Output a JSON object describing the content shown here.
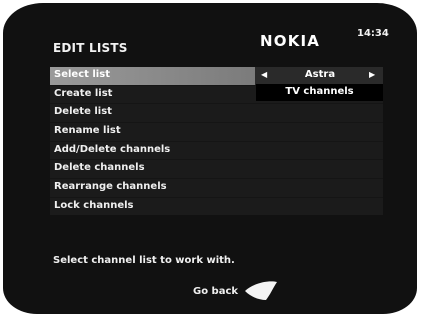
{
  "header": {
    "title": "EDIT LISTS",
    "brand": "NOKIA",
    "time": "14:34"
  },
  "menu": {
    "items": [
      {
        "label": "Select list"
      },
      {
        "label": "Create list"
      },
      {
        "label": "Delete list"
      },
      {
        "label": "Rename list"
      },
      {
        "label": "Add/Delete channels"
      },
      {
        "label": "Delete channels"
      },
      {
        "label": "Rearrange channels"
      },
      {
        "label": "Lock channels"
      }
    ],
    "selected_index": 0,
    "selected_value": "Astra",
    "dropdown_options": [
      "TV channels"
    ]
  },
  "help_text": "Select channel list to work with.",
  "footer": {
    "back_label": "Go back",
    "back_icon": "back-key-icon"
  },
  "colors": {
    "screen_bg": "#111111",
    "row_bg": "#1b1b1b",
    "highlight": "#8a8a8a",
    "text": "#f0f0f0"
  }
}
